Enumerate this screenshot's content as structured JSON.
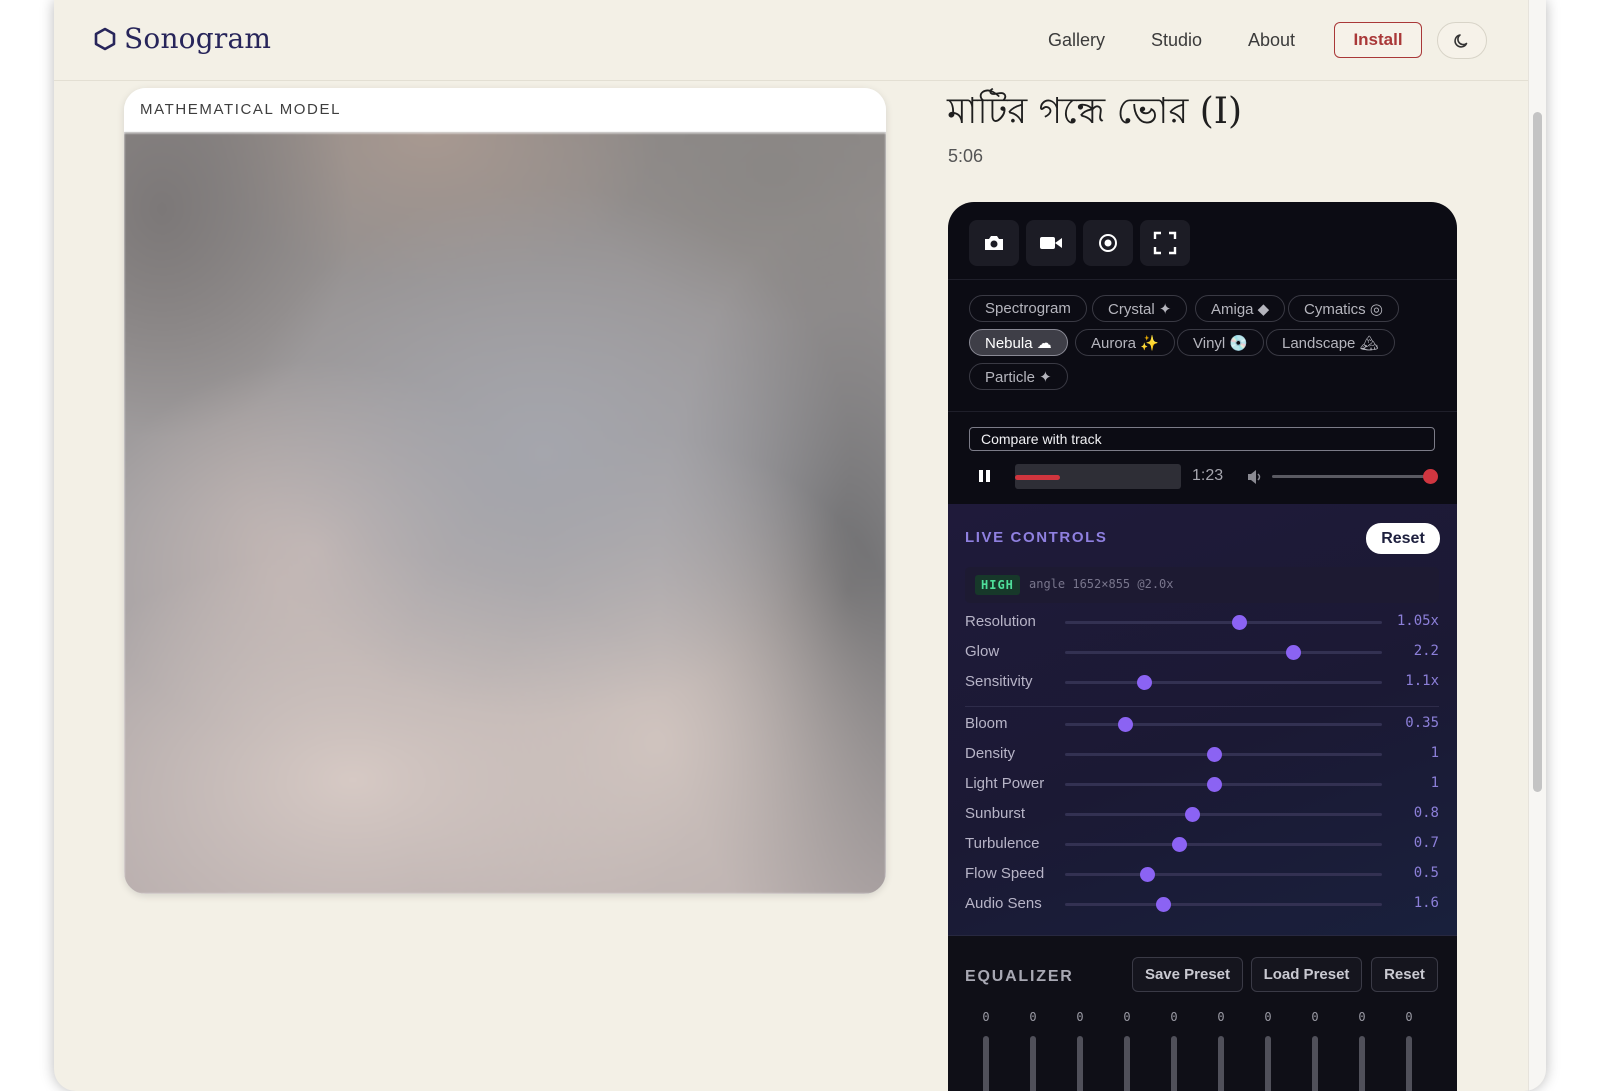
{
  "header": {
    "logo_text_main": "Sonogram",
    "nav": [
      "Gallery",
      "Studio",
      "About"
    ],
    "install_label": "Install"
  },
  "visual": {
    "label": "MATHEMATICAL MODEL"
  },
  "track": {
    "title": "মাটির গন্ধে ভোর (I)",
    "duration": "5:06"
  },
  "toolbar": {
    "tools": [
      "camera-icon",
      "video-camera-icon",
      "record-icon",
      "fullscreen-icon"
    ]
  },
  "modes": [
    {
      "label": "Spectrogram",
      "active": false
    },
    {
      "label": "Crystal ✦",
      "active": false
    },
    {
      "label": "Amiga ◆",
      "active": false
    },
    {
      "label": "Cymatics ◎",
      "active": false
    },
    {
      "label": "Nebula ☁",
      "active": true
    },
    {
      "label": "Aurora ✨",
      "active": false
    },
    {
      "label": "Vinyl 💿",
      "active": false
    },
    {
      "label": "Landscape 🏔",
      "active": false
    },
    {
      "label": "Particle ✦",
      "active": false
    }
  ],
  "player": {
    "compare_label": "Compare with track",
    "time": "1:23",
    "progress": 0.27,
    "volume": 1.0,
    "accent": "#d0353e"
  },
  "live_controls": {
    "title": "LIVE CONTROLS",
    "reset_label": "Reset",
    "quality_badge": "HIGH",
    "quality_info": "angle 1652×855 @2.0x",
    "accent": "#8b63f3",
    "sliders": [
      {
        "label": "Resolution",
        "value": "1.05x",
        "level": 0.55
      },
      {
        "label": "Glow",
        "value": "2.2",
        "level": 0.72
      },
      {
        "label": "Sensitivity",
        "value": "1.1x",
        "level": 0.25
      },
      {
        "label": "Bloom",
        "value": "0.35",
        "level": 0.19
      },
      {
        "label": "Density",
        "value": "1",
        "level": 0.47
      },
      {
        "label": "Light Power",
        "value": "1",
        "level": 0.47
      },
      {
        "label": "Sunburst",
        "value": "0.8",
        "level": 0.4
      },
      {
        "label": "Turbulence",
        "value": "0.7",
        "level": 0.36
      },
      {
        "label": "Flow Speed",
        "value": "0.5",
        "level": 0.26
      },
      {
        "label": "Audio Sens",
        "value": "1.6",
        "level": 0.31
      }
    ]
  },
  "equalizer": {
    "title": "EQUALIZER",
    "save_label": "Save Preset",
    "load_label": "Load Preset",
    "reset_label": "Reset",
    "bands": [
      "0",
      "0",
      "0",
      "0",
      "0",
      "0",
      "0",
      "0",
      "0",
      "0"
    ],
    "accent": "#29a8e8"
  }
}
